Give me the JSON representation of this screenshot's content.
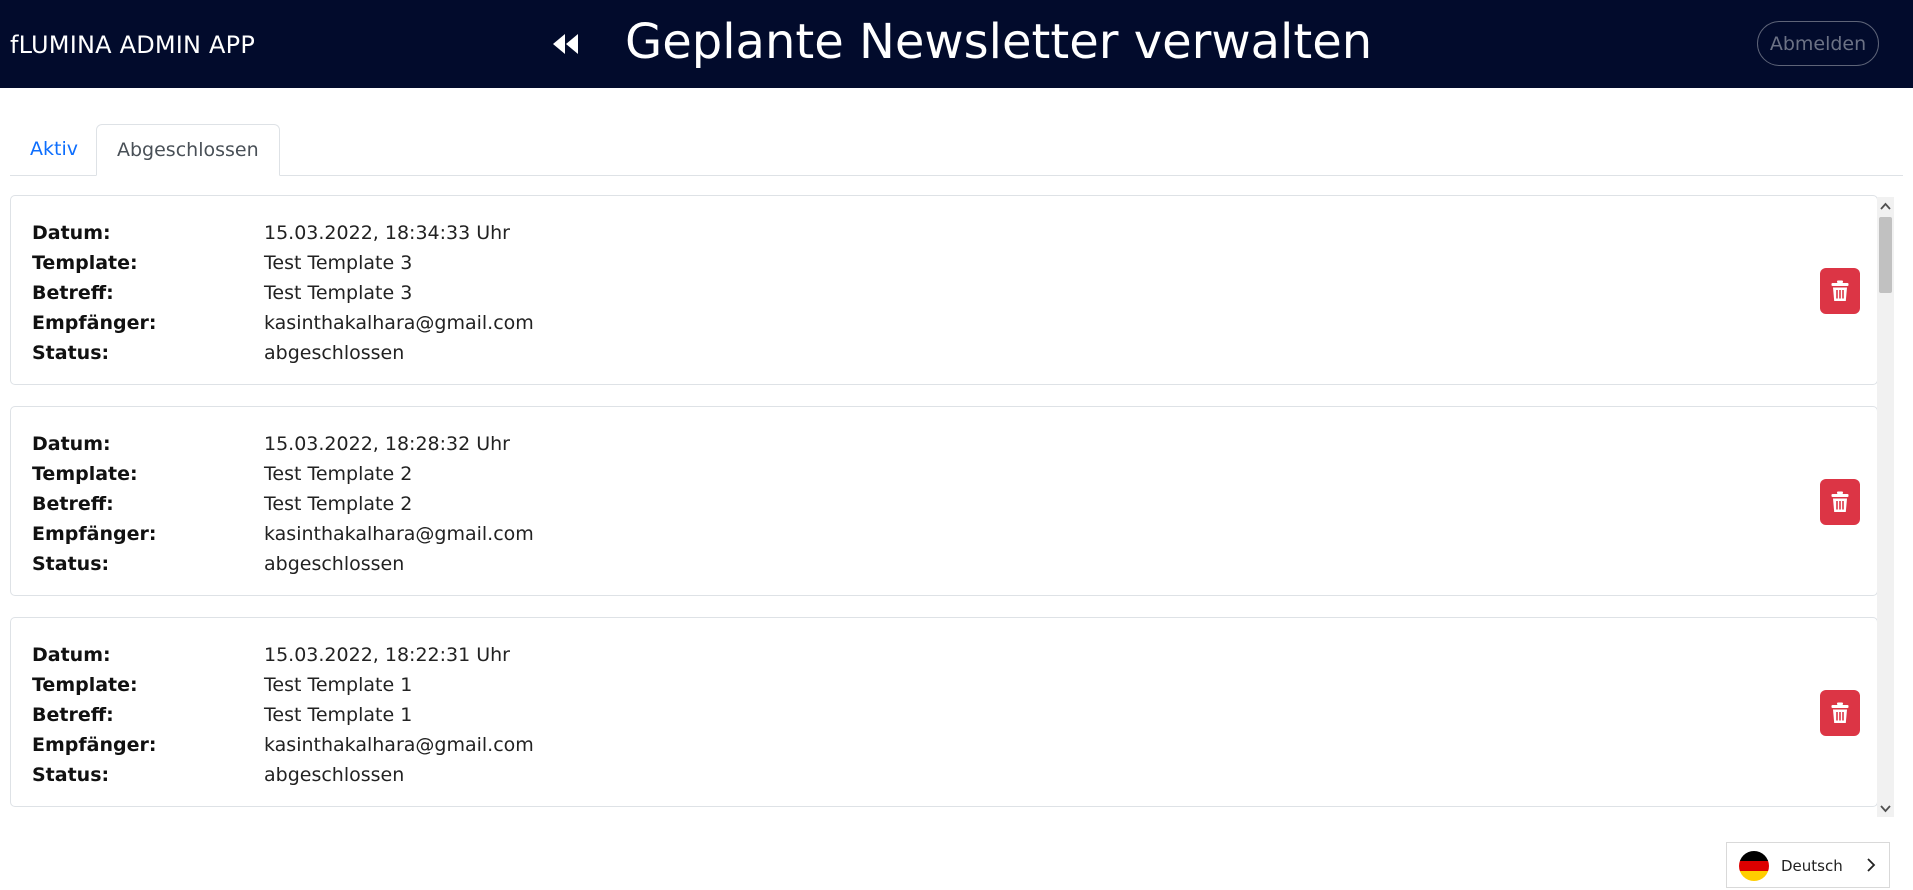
{
  "header": {
    "app_title": "fLUMINA ADMIN APP",
    "page_title": "Geplante Newsletter verwalten",
    "logout_label": "Abmelden",
    "background_color": "#020b2c"
  },
  "tabs": [
    {
      "label": "Aktiv",
      "active": false
    },
    {
      "label": "Abgeschlossen",
      "active": true
    }
  ],
  "field_labels": {
    "date": "Datum:",
    "template": "Template:",
    "subject": "Betreff:",
    "recipient": "Empfänger:",
    "status": "Status:"
  },
  "newsletters": [
    {
      "date": "15.03.2022, 18:34:33 Uhr",
      "template": "Test Template 3",
      "subject": "Test Template 3",
      "recipient": "kasinthakalhara@gmail.com",
      "status": "abgeschlossen"
    },
    {
      "date": "15.03.2022, 18:28:32 Uhr",
      "template": "Test Template 2",
      "subject": "Test Template 2",
      "recipient": "kasinthakalhara@gmail.com",
      "status": "abgeschlossen"
    },
    {
      "date": "15.03.2022, 18:22:31 Uhr",
      "template": "Test Template 1",
      "subject": "Test Template 1",
      "recipient": "kasinthakalhara@gmail.com",
      "status": "abgeschlossen"
    }
  ],
  "language": {
    "label": "Deutsch",
    "flag_icon": "germany-flag-icon"
  },
  "colors": {
    "delete": "#dc3545",
    "tab_link": "#0d6efd"
  }
}
